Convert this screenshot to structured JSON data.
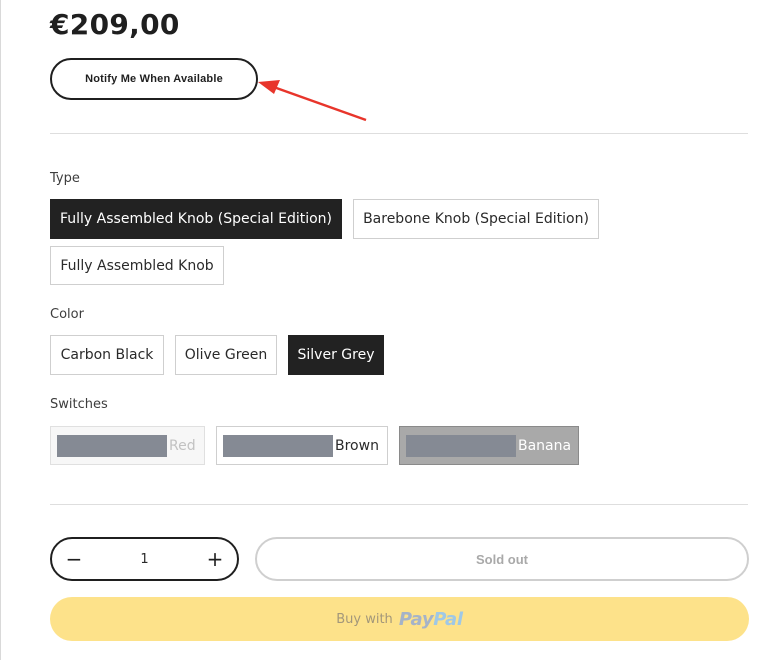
{
  "product": {
    "price": "€209,00",
    "notify_label": "Notify Me When Available"
  },
  "options": {
    "type": {
      "label": "Type",
      "items": [
        {
          "label": "Fully Assembled Knob (Special Edition)",
          "selected": true
        },
        {
          "label": "Barebone Knob (Special Edition)",
          "selected": false
        },
        {
          "label": "Fully Assembled Knob",
          "selected": false
        }
      ]
    },
    "color": {
      "label": "Color",
      "items": [
        {
          "label": "Carbon Black",
          "selected": false
        },
        {
          "label": "Olive Green",
          "selected": false
        },
        {
          "label": "Silver Grey",
          "selected": true
        }
      ]
    },
    "switches": {
      "label": "Switches",
      "items": [
        {
          "label": "Red",
          "state": "disabled"
        },
        {
          "label": "Brown",
          "state": "available"
        },
        {
          "label": "Banana",
          "state": "selected"
        }
      ]
    }
  },
  "cart": {
    "quantity": "1",
    "decrement_symbol": "−",
    "increment_symbol": "+",
    "sold_out_label": "Sold out",
    "paypal_prefix": "Buy with",
    "paypal_logo_pay": "Pay",
    "paypal_logo_pal": "Pal"
  },
  "colors": {
    "primary": "#222222",
    "annotation_arrow": "#e8352b",
    "paypal_button": "#fde28a",
    "redaction": "#858a94"
  }
}
